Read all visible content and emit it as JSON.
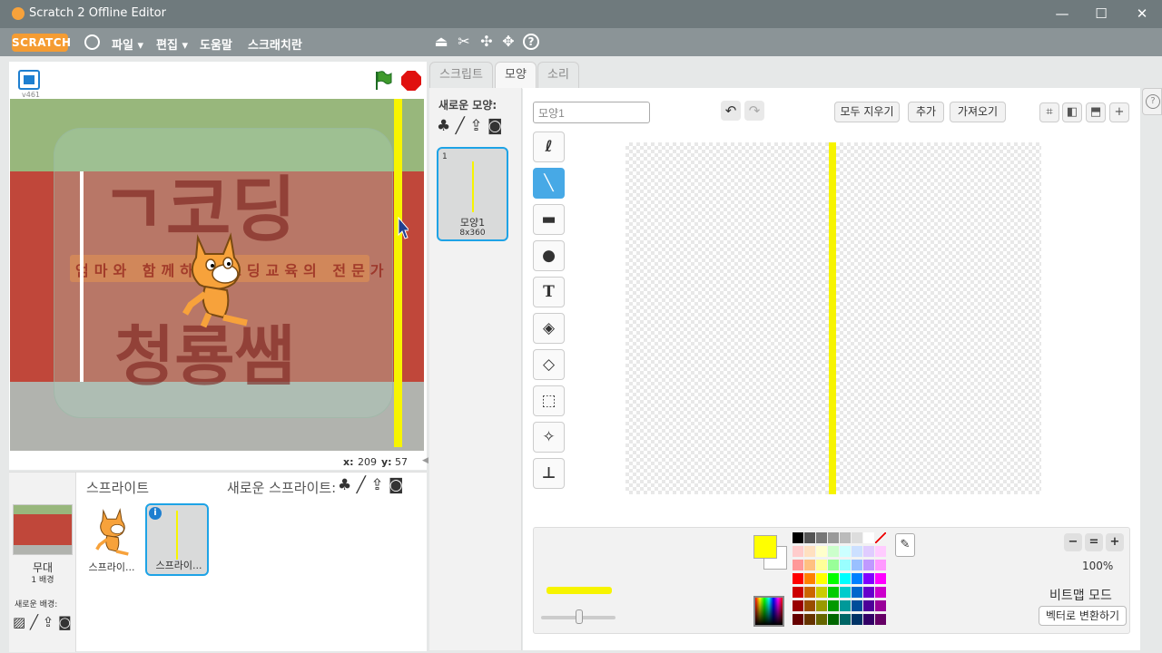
{
  "window": {
    "title": "Scratch 2 Offline Editor"
  },
  "menubar": {
    "logo": "SCRATCH",
    "items": [
      "파일 ▾",
      "편집 ▾",
      "도움말",
      "스크래치란"
    ],
    "tools": [
      "duplicate-icon",
      "delete-icon",
      "grow-icon",
      "shrink-icon",
      "help-icon"
    ]
  },
  "stage": {
    "version": "v461",
    "coords": {
      "x_label": "x:",
      "x": "209",
      "y_label": "y:",
      "y": "57"
    },
    "watermark": {
      "top": "ㄱ코딩",
      "ribbon": "엄마와 함께하는 코딩교육의 전문가",
      "bottom": "청룡쌤"
    }
  },
  "sprites_panel": {
    "title": "스프라이트",
    "new_sprite_label": "새로운 스프라이트:",
    "stage_label": "무대",
    "stage_count": "1 배경",
    "new_backdrop_label": "새로운 배경:",
    "sprites": [
      {
        "name": "스프라이...",
        "selected": false
      },
      {
        "name": "스프라이...",
        "selected": true
      }
    ]
  },
  "tabs": [
    "스크립트",
    "모양",
    "소리"
  ],
  "costumes": {
    "new_costume_label": "새로운 모양:",
    "items": [
      {
        "number": "1",
        "name": "모양1",
        "size": "8x360"
      }
    ]
  },
  "editor": {
    "costume_name": "모양1",
    "clear_label": "모두 지우기",
    "add_label": "추가",
    "import_label": "가져오기",
    "zoom_level": "100%",
    "mode_label": "비트맵 모드",
    "convert_label": "벡터로 변환하기",
    "tools": [
      "brush-icon",
      "line-icon",
      "rectangle-icon",
      "ellipse-icon",
      "text-icon",
      "fill-icon",
      "eraser-icon",
      "select-icon",
      "magic-select-icon",
      "stamp-icon"
    ],
    "active_tool": "line-icon",
    "foreground_color": "#ffff00",
    "background_color": "#ffffff",
    "palette": [
      "#000000",
      "#555555",
      "#777777",
      "#999999",
      "#bbbbbb",
      "#dddddd",
      "#ffffff",
      "none",
      "#ffcccc",
      "#ffe0c0",
      "#ffffcc",
      "#ccffcc",
      "#ccffff",
      "#cce0ff",
      "#e0ccff",
      "#ffccff",
      "#ff9999",
      "#ffc080",
      "#ffff99",
      "#99ff99",
      "#99ffff",
      "#99c0ff",
      "#c099ff",
      "#ff99ff",
      "#ff0000",
      "#ff8000",
      "#ffff00",
      "#00ff00",
      "#00ffff",
      "#0080ff",
      "#8000ff",
      "#ff00ff",
      "#cc0000",
      "#cc6600",
      "#cccc00",
      "#00cc00",
      "#00cccc",
      "#0066cc",
      "#6600cc",
      "#cc00cc",
      "#990000",
      "#994d00",
      "#999900",
      "#009900",
      "#009999",
      "#004d99",
      "#4d0099",
      "#990099",
      "#660000",
      "#663300",
      "#666600",
      "#006600",
      "#006666",
      "#003366",
      "#330066",
      "#660066"
    ]
  }
}
